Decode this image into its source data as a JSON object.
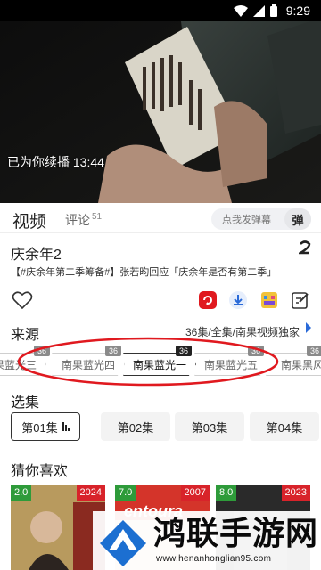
{
  "status_bar": {
    "time": "9:29",
    "icons": [
      "wifi-icon",
      "signal-icon",
      "battery-icon"
    ]
  },
  "video": {
    "resume_text": "已为你续播 13:44"
  },
  "tabs": {
    "video": "视频",
    "comment": "评论",
    "comment_count": "51"
  },
  "danmaku": {
    "placeholder": "点我发弹幕",
    "button": "弹"
  },
  "show": {
    "title": "庆余年2",
    "notice": "【#庆余年第二季筹备#】张若昀回应「庆余年是否有第二季」"
  },
  "actions": [
    "heart-icon",
    "repost-icon",
    "download-icon",
    "gift-icon",
    "edit-icon"
  ],
  "source": {
    "label": "来源",
    "info": "36集/全集/南果视频独家",
    "items": [
      {
        "name": "南果蓝光三",
        "badge": "36",
        "active": false
      },
      {
        "name": "南果蓝光四",
        "badge": "36",
        "active": false
      },
      {
        "name": "南果蓝光一",
        "badge": "36",
        "active": true
      },
      {
        "name": "南果蓝光五",
        "badge": "36",
        "active": false
      },
      {
        "name": "南果黑风",
        "badge": "36",
        "active": false
      }
    ]
  },
  "episodes": {
    "label": "选集",
    "items": [
      "第01集",
      "第02集",
      "第03集",
      "第04集"
    ],
    "active_index": 0
  },
  "recommend": {
    "label": "猜你喜欢",
    "items": [
      {
        "rating": "2.0",
        "year": "2024"
      },
      {
        "rating": "7.0",
        "year": "2007",
        "poster_text": "entoura"
      },
      {
        "rating": "8.0",
        "year": "2023"
      }
    ]
  },
  "watermark": {
    "text": "鸿联手游网",
    "url": "www.henanhonglian95.com"
  },
  "colors": {
    "accent": "#2a6ad8",
    "highlight": "#e0191f",
    "rating": "#2e9b3a",
    "year": "#d8232a"
  }
}
